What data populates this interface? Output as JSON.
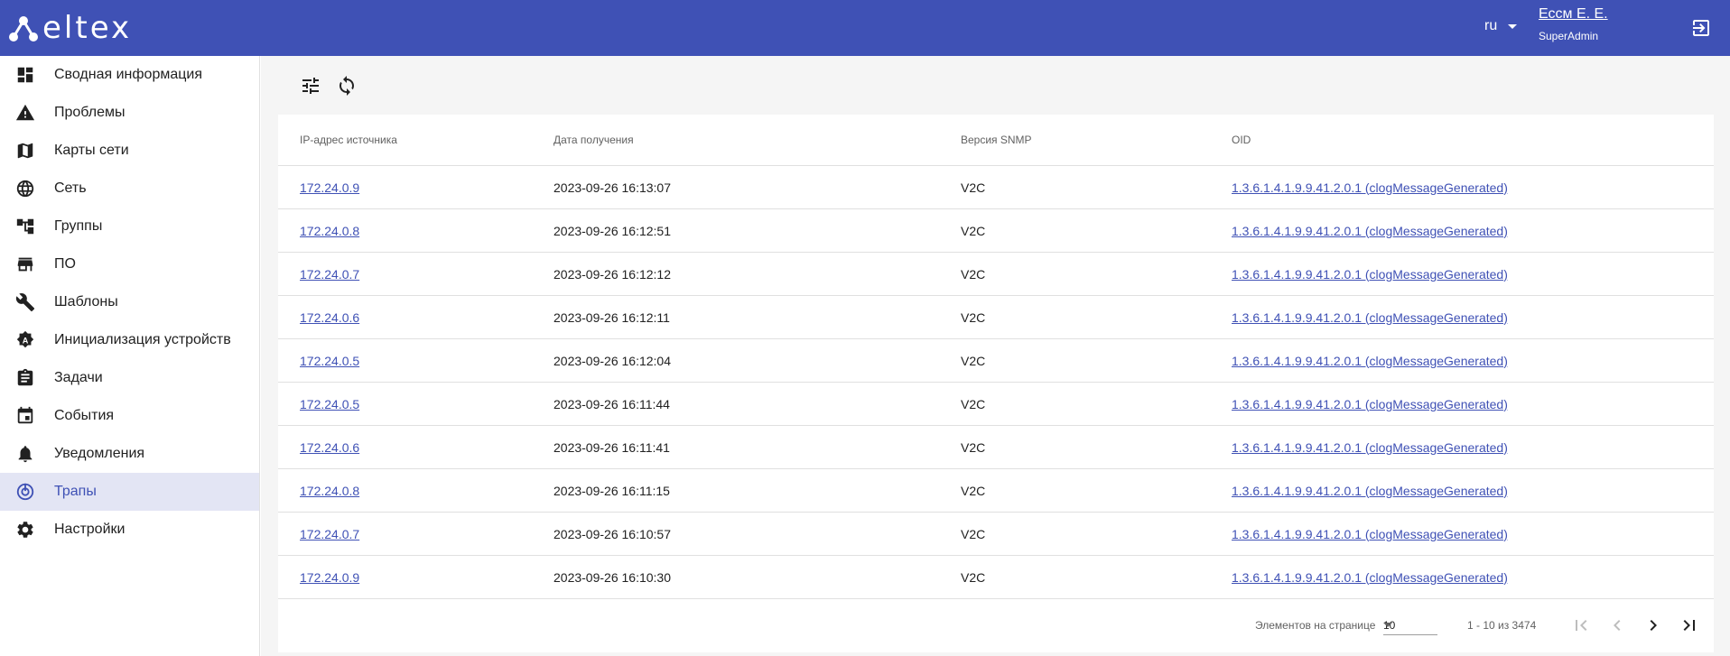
{
  "brand": {
    "logo_text": "eltex"
  },
  "header": {
    "language": "ru",
    "user_name": "Ессм Е. Е.",
    "user_role": "SuperAdmin"
  },
  "sidebar": {
    "items": [
      {
        "label": "Сводная информация",
        "icon": "dashboard-icon"
      },
      {
        "label": "Проблемы",
        "icon": "warning-icon"
      },
      {
        "label": "Карты сети",
        "icon": "map-icon"
      },
      {
        "label": "Сеть",
        "icon": "globe-icon"
      },
      {
        "label": "Группы",
        "icon": "tree-icon"
      },
      {
        "label": "ПО",
        "icon": "store-icon"
      },
      {
        "label": "Шаблоны",
        "icon": "wrench-icon"
      },
      {
        "label": "Инициализация устройств",
        "icon": "auto-gear-icon"
      },
      {
        "label": "Задачи",
        "icon": "clipboard-icon"
      },
      {
        "label": "События",
        "icon": "calendar-icon"
      },
      {
        "label": "Уведомления",
        "icon": "bell-icon"
      },
      {
        "label": "Трапы",
        "icon": "trap-icon",
        "active": true
      },
      {
        "label": "Настройки",
        "icon": "gear-icon"
      }
    ]
  },
  "table": {
    "columns": [
      "IP-адрес источника",
      "Дата получения",
      "Версия SNMP",
      "OID"
    ],
    "rows": [
      [
        "172.24.0.9",
        "2023-09-26 16:13:07",
        "V2C",
        "1.3.6.1.4.1.9.9.41.2.0.1 (clogMessageGenerated)"
      ],
      [
        "172.24.0.8",
        "2023-09-26 16:12:51",
        "V2C",
        "1.3.6.1.4.1.9.9.41.2.0.1 (clogMessageGenerated)"
      ],
      [
        "172.24.0.7",
        "2023-09-26 16:12:12",
        "V2C",
        "1.3.6.1.4.1.9.9.41.2.0.1 (clogMessageGenerated)"
      ],
      [
        "172.24.0.6",
        "2023-09-26 16:12:11",
        "V2C",
        "1.3.6.1.4.1.9.9.41.2.0.1 (clogMessageGenerated)"
      ],
      [
        "172.24.0.5",
        "2023-09-26 16:12:04",
        "V2C",
        "1.3.6.1.4.1.9.9.41.2.0.1 (clogMessageGenerated)"
      ],
      [
        "172.24.0.5",
        "2023-09-26 16:11:44",
        "V2C",
        "1.3.6.1.4.1.9.9.41.2.0.1 (clogMessageGenerated)"
      ],
      [
        "172.24.0.6",
        "2023-09-26 16:11:41",
        "V2C",
        "1.3.6.1.4.1.9.9.41.2.0.1 (clogMessageGenerated)"
      ],
      [
        "172.24.0.8",
        "2023-09-26 16:11:15",
        "V2C",
        "1.3.6.1.4.1.9.9.41.2.0.1 (clogMessageGenerated)"
      ],
      [
        "172.24.0.7",
        "2023-09-26 16:10:57",
        "V2C",
        "1.3.6.1.4.1.9.9.41.2.0.1 (clogMessageGenerated)"
      ],
      [
        "172.24.0.9",
        "2023-09-26 16:10:30",
        "V2C",
        "1.3.6.1.4.1.9.9.41.2.0.1 (clogMessageGenerated)"
      ]
    ]
  },
  "paginator": {
    "label": "Элементов на странице",
    "page_size": "10",
    "range": "1 - 10 из 3474"
  },
  "colors": {
    "primary": "#3f51b5",
    "active_bg": "#e3e5f4",
    "toolbar_bg": "#f5f5f5"
  }
}
